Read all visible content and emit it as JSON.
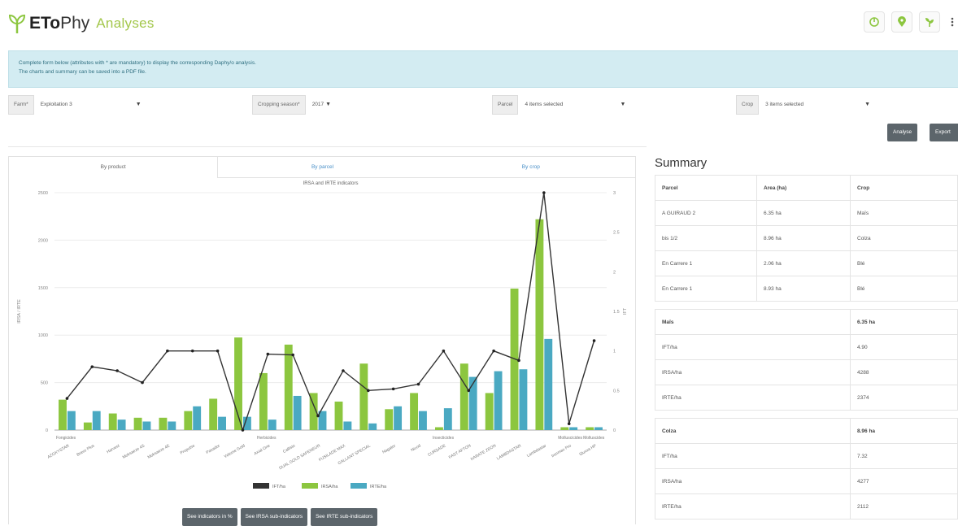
{
  "header": {
    "brand_bold": "ETo",
    "brand_thin": "Phy",
    "brand_sub": "Analyses",
    "icons": [
      "chart-icon",
      "map-pin-icon",
      "plant-icon",
      "more-icon"
    ]
  },
  "info": {
    "line1": "Complete form below (attributes with * are mandatory) to display the corresponding Daphy/o analysis.",
    "line2": "The charts and summary can be saved into a PDF file."
  },
  "filters": {
    "farm_label": "Farm*",
    "farm_value": "Exploitation 3",
    "season_label": "Cropping season*",
    "season_value": "2017",
    "parcel_label": "Parcel",
    "parcel_value": "4 items selected",
    "crop_label": "Crop",
    "crop_value": "3 items selected"
  },
  "actions": {
    "analyse": "Analyse",
    "export": "Export"
  },
  "tabs": [
    "By product",
    "By parcel",
    "By crop"
  ],
  "bottom_buttons": [
    "See indicators in %",
    "See IRSA sub-indicators",
    "See IRTE sub-indicators"
  ],
  "colors": {
    "ift": "#333333",
    "irsa": "#8cc63f",
    "irte": "#4aa9c2",
    "accent": "#a3c74b",
    "info_bg": "#d3ecf2"
  },
  "chart_data": {
    "type": "bar",
    "title": "IRSA and IRTE indicators",
    "ylabel_left": "IRSA / IRTE",
    "ylabel_right": "IFT",
    "ylim": [
      0,
      2500
    ],
    "y2lim": [
      0,
      3.0
    ],
    "yticks": [
      0,
      500,
      1000,
      1500,
      2000,
      2500
    ],
    "y2ticks": [
      0,
      0.5,
      1.0,
      1.5,
      2.0,
      2.5,
      3.0
    ],
    "groups": [
      "Fongicides",
      "Herbicides",
      "Insecticides",
      "Molluscicides",
      "Molluscides"
    ],
    "categories": [
      "AZOXYSTAR",
      "Bravo Plus",
      "Harvest",
      "Moksaeze 4S",
      "Moksaeze 4E",
      "Propulse",
      "Pasador",
      "Velome Gold",
      "Axial One",
      "Callisto",
      "DUAL GOLD SAFENEUR",
      "FUSILADE MAX",
      "GALLANT SPECIAL",
      "Nagator",
      "Nicod",
      "CURSADE",
      "FAST AFTON",
      "KARATE ZEON",
      "LAMBDASTAR",
      "Lambdastar",
      "Ironmax Pro",
      "Sluxxa HP"
    ],
    "series": [
      {
        "name": "IFT/ha",
        "values": [
          0.4,
          0.8,
          0.75,
          0.6,
          1.0,
          1.0,
          1.0,
          0.0,
          0.96,
          0.95,
          0.18,
          0.75,
          0.5,
          0.52,
          0.58,
          1.0,
          0.5,
          1.0,
          0.88,
          3.0,
          0.08,
          1.13
        ]
      },
      {
        "name": "IRSA/ha",
        "values": [
          320,
          80,
          175,
          130,
          130,
          200,
          330,
          975,
          600,
          900,
          390,
          300,
          700,
          220,
          390,
          30,
          700,
          390,
          1490,
          2220,
          30,
          30
        ]
      },
      {
        "name": "IRTE/ha",
        "values": [
          200,
          200,
          110,
          90,
          90,
          250,
          140,
          140,
          110,
          360,
          200,
          90,
          70,
          250,
          200,
          230,
          560,
          620,
          640,
          960,
          30,
          30
        ]
      }
    ],
    "legend": "bottom"
  },
  "summary": {
    "title": "Summary",
    "headers": [
      "Parcel",
      "Area (ha)",
      "Crop"
    ],
    "parcels": [
      [
        "A GUIRAUD 2",
        "6.35 ha",
        "Maïs"
      ],
      [
        "bis 1/2",
        "8.96 ha",
        "Colza"
      ],
      [
        "En Carrere 1",
        "2.06 ha",
        "Blé"
      ],
      [
        "En Carrere 1",
        "8.93 ha",
        "Blé"
      ]
    ],
    "crops": [
      {
        "name": "Maïs",
        "area": "6.35 ha",
        "rows": [
          [
            "IFT/ha",
            "4.90"
          ],
          [
            "IRSA/ha",
            "4288"
          ],
          [
            "IRTE/ha",
            "2374"
          ]
        ]
      },
      {
        "name": "Colza",
        "area": "8.96 ha",
        "rows": [
          [
            "IFT/ha",
            "7.32"
          ],
          [
            "IRSA/ha",
            "4277"
          ],
          [
            "IRTE/ha",
            "2112"
          ]
        ]
      }
    ]
  }
}
